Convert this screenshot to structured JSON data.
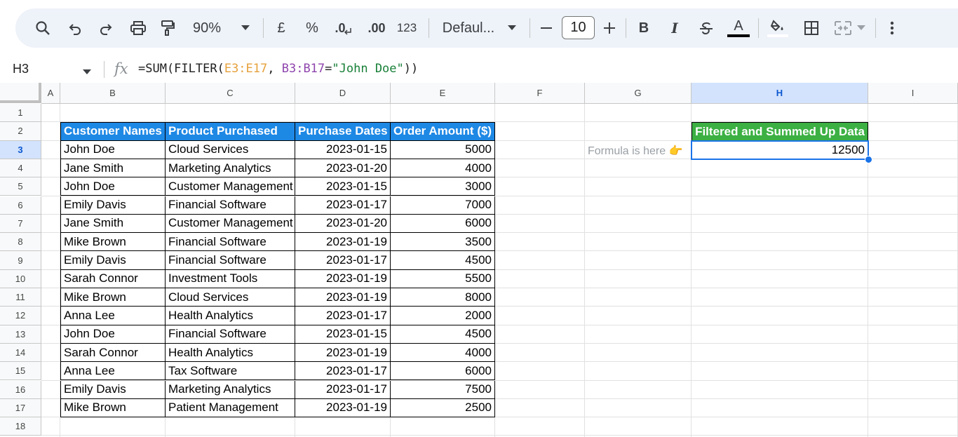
{
  "toolbar": {
    "zoom": "90%",
    "currency": "£",
    "percent": "%",
    "decrease_decimal": ".0",
    "increase_decimal": ".00",
    "number_format": "123",
    "font_name": "Defaul...",
    "font_size": "10",
    "bold": "B",
    "italic": "I",
    "text_color_letter": "A"
  },
  "formula_bar": {
    "cell_ref": "H3",
    "fx": "fx",
    "formula_prefix": "=SUM(FILTER(",
    "formula_range1": "E3:E17",
    "formula_sep": ", ",
    "formula_range2": "B3:B17",
    "formula_eq": "=",
    "formula_string": "\"John Doe\"",
    "formula_suffix": "))"
  },
  "columns": [
    "A",
    "B",
    "C",
    "D",
    "E",
    "F",
    "G",
    "H",
    "I"
  ],
  "rows": [
    "1",
    "2",
    "3",
    "4",
    "5",
    "6",
    "7",
    "8",
    "9",
    "10",
    "11",
    "12",
    "13",
    "14",
    "15",
    "16",
    "17",
    "18"
  ],
  "table": {
    "headers": [
      "Customer Names",
      "Product Purchased",
      "Purchase Dates",
      "Order Amount ($)"
    ],
    "data": [
      [
        "John Doe",
        "Cloud Services",
        "2023-01-15",
        "5000"
      ],
      [
        "Jane Smith",
        "Marketing Analytics",
        "2023-01-20",
        "4000"
      ],
      [
        "John Doe",
        "Customer Management",
        "2023-01-15",
        "3000"
      ],
      [
        "Emily Davis",
        "Financial Software",
        "2023-01-17",
        "7000"
      ],
      [
        "Jane Smith",
        "Customer Management",
        "2023-01-20",
        "6000"
      ],
      [
        "Mike Brown",
        "Financial Software",
        "2023-01-19",
        "3500"
      ],
      [
        "Emily Davis",
        "Financial Software",
        "2023-01-17",
        "4500"
      ],
      [
        "Sarah Connor",
        "Investment Tools",
        "2023-01-19",
        "5500"
      ],
      [
        "Mike Brown",
        "Cloud Services",
        "2023-01-19",
        "8000"
      ],
      [
        "Anna Lee",
        "Health Analytics",
        "2023-01-17",
        "2000"
      ],
      [
        "John Doe",
        "Financial Software",
        "2023-01-15",
        "4500"
      ],
      [
        "Sarah Connor",
        "Health Analytics",
        "2023-01-19",
        "4000"
      ],
      [
        "Anna Lee",
        "Tax Software",
        "2023-01-17",
        "6000"
      ],
      [
        "Emily Davis",
        "Marketing Analytics",
        "2023-01-17",
        "7500"
      ],
      [
        "Mike Brown",
        "Patient Management",
        "2023-01-19",
        "2500"
      ]
    ]
  },
  "result": {
    "header": "Filtered and Summed Up Data",
    "note": "Formula is here 👉",
    "value": "12500"
  },
  "selection": {
    "active_column": "H",
    "active_row": "3"
  },
  "colors": {
    "table_header_bg": "#1e88e5",
    "result_header_bg": "#3cb043",
    "selection": "#1a73e8"
  }
}
